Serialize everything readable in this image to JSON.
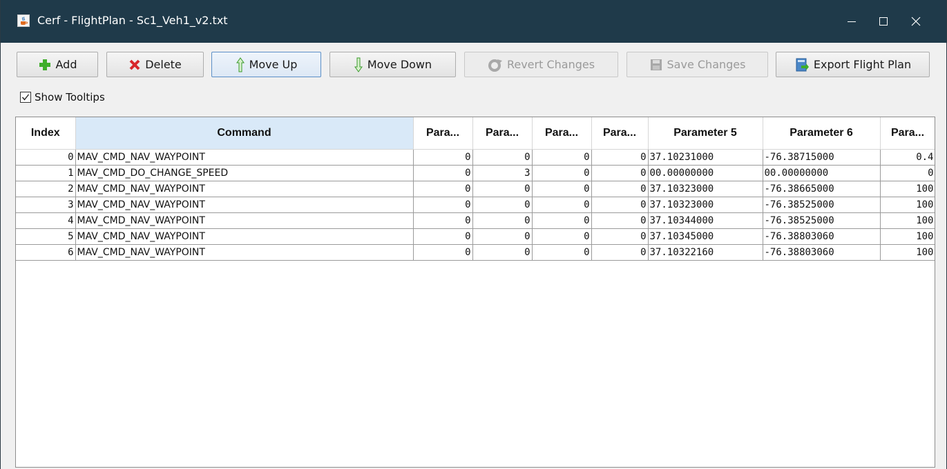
{
  "window": {
    "title": "Cerf - FlightPlan - Sc1_Veh1_v2.txt",
    "app_icon": "java-cup-icon",
    "controls": [
      "minimize-icon",
      "maximize-icon",
      "close-icon"
    ]
  },
  "toolbar": {
    "add_label": "Add",
    "delete_label": "Delete",
    "move_up_label": "Move Up",
    "move_down_label": "Move Down",
    "revert_label": "Revert Changes",
    "save_label": "Save Changes",
    "export_label": "Export Flight Plan"
  },
  "options": {
    "show_tooltips_label": "Show Tooltips",
    "show_tooltips_checked": true
  },
  "table": {
    "headers": [
      "Index",
      "Command",
      "Para...",
      "Para...",
      "Para...",
      "Para...",
      "Parameter 5",
      "Parameter 6",
      "Para..."
    ],
    "selected_column": 1,
    "rows": [
      [
        "0",
        "MAV_CMD_NAV_WAYPOINT",
        "0",
        "0",
        "0",
        "0",
        "37.10231000",
        "-76.38715000",
        "0.4"
      ],
      [
        "1",
        "MAV_CMD_DO_CHANGE_SPEED",
        "0",
        "3",
        "0",
        "0",
        "00.00000000",
        "00.00000000",
        "0"
      ],
      [
        "2",
        "MAV_CMD_NAV_WAYPOINT",
        "0",
        "0",
        "0",
        "0",
        "37.10323000",
        "-76.38665000",
        "100"
      ],
      [
        "3",
        "MAV_CMD_NAV_WAYPOINT",
        "0",
        "0",
        "0",
        "0",
        "37.10323000",
        "-76.38525000",
        "100"
      ],
      [
        "4",
        "MAV_CMD_NAV_WAYPOINT",
        "0",
        "0",
        "0",
        "0",
        "37.10344000",
        "-76.38525000",
        "100"
      ],
      [
        "5",
        "MAV_CMD_NAV_WAYPOINT",
        "0",
        "0",
        "0",
        "0",
        "37.10345000",
        "-76.38803060",
        "100"
      ],
      [
        "6",
        "MAV_CMD_NAV_WAYPOINT",
        "0",
        "0",
        "0",
        "0",
        "37.10322160",
        "-76.38803060",
        "100"
      ]
    ]
  },
  "colors": {
    "titlebar": "#1f3a4a",
    "selected_header": "#d9e9f8",
    "add_green": "#3fae2a",
    "delete_red": "#d8262b",
    "arrow_green": "#3a9a2a"
  }
}
